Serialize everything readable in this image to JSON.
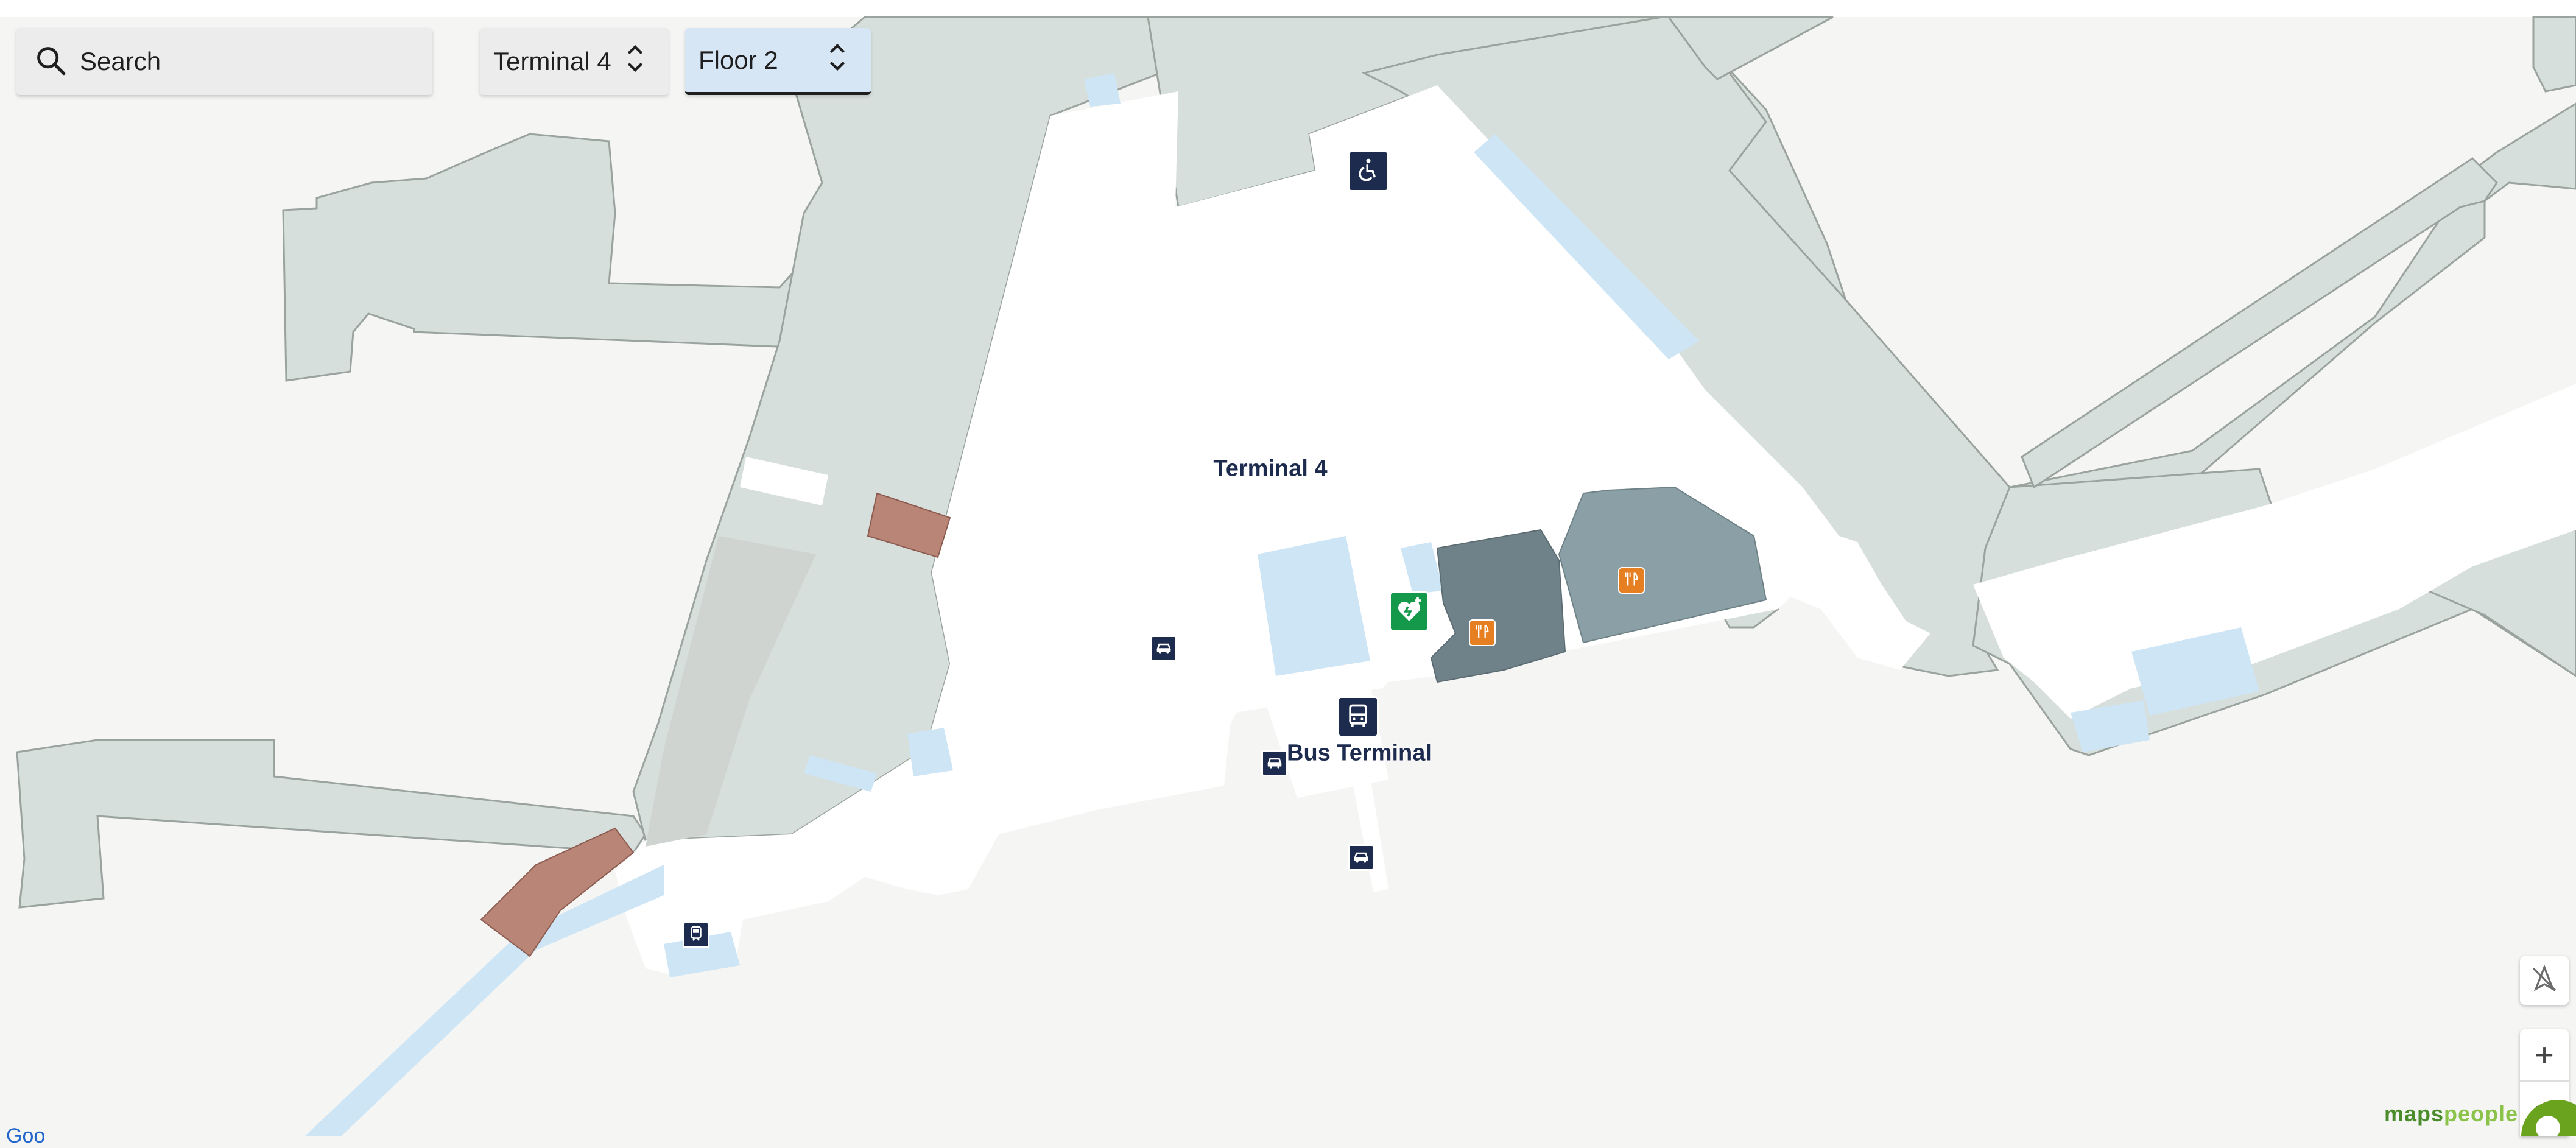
{
  "search": {
    "label": "Search",
    "icon": "search-icon"
  },
  "selectors": {
    "building": {
      "value": "Terminal 4",
      "icon": "chevron-updown-icon"
    },
    "floor": {
      "value": "Floor 2",
      "icon": "chevron-updown-icon"
    }
  },
  "map": {
    "labels": {
      "terminal": "Terminal 4",
      "bus_terminal": "Bus Terminal"
    },
    "pois": [
      {
        "icon": "wheelchair-icon"
      },
      {
        "icon": "bus-icon"
      },
      {
        "icon": "car-icon"
      },
      {
        "icon": "car-icon"
      },
      {
        "icon": "car-icon"
      },
      {
        "icon": "train-icon"
      },
      {
        "icon": "aed-heart-icon"
      },
      {
        "icon": "restaurant-icon"
      },
      {
        "icon": "restaurant-icon"
      }
    ]
  },
  "controls": {
    "reset_bearing": {
      "icon": "compass-reset-icon"
    },
    "zoom_in": {
      "label": "+"
    },
    "zoom_out": {
      "label": "−"
    }
  },
  "branding": {
    "logo_maps": "maps",
    "logo_people": "people"
  },
  "attribution": "Goo"
}
